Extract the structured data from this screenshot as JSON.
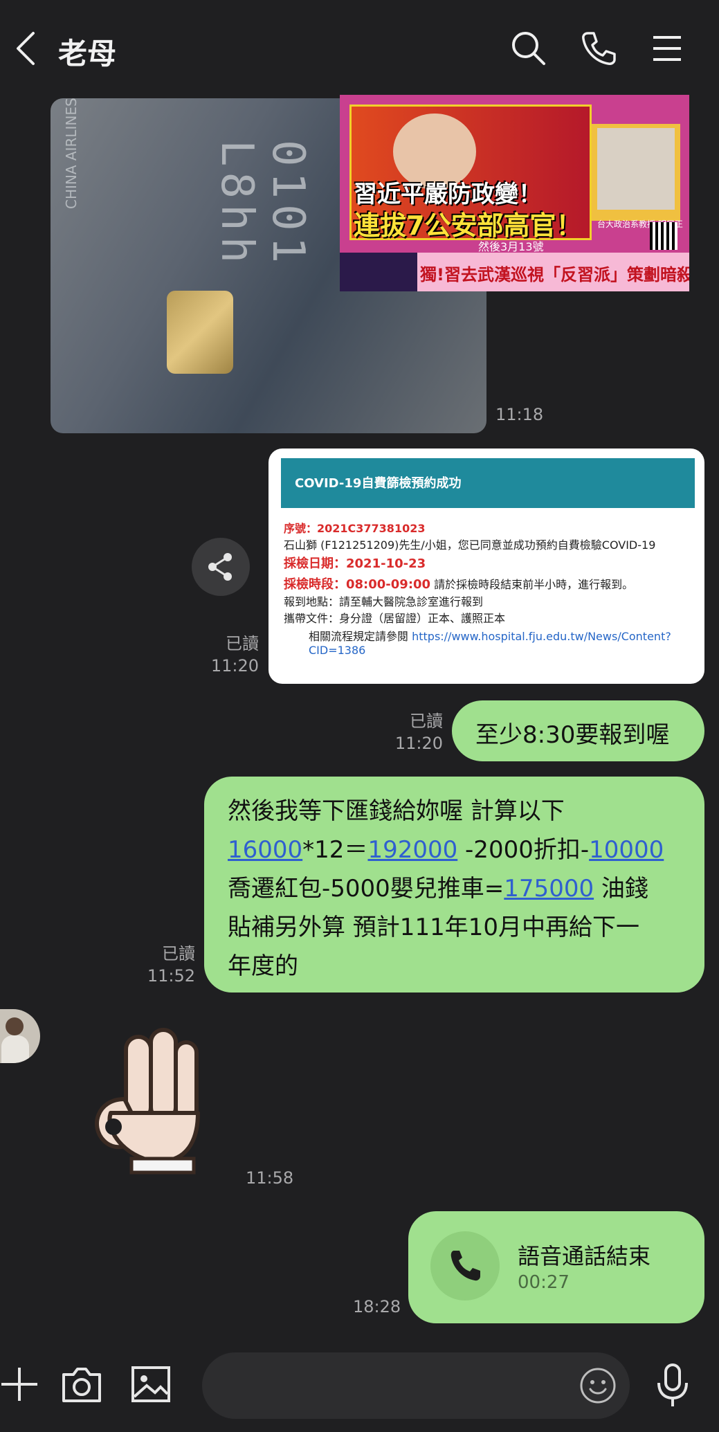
{
  "header": {
    "title": "老母"
  },
  "messages": {
    "card_time": "11:18",
    "news": {
      "headline1": "習近平嚴防政變！",
      "headline2": "連拔7公安部高官！",
      "date": "然後3月13號",
      "bar": "獨!習去武漢巡視「反習派」策劃暗殺!背後操盤手是江派?!",
      "side_label": "台大政治系教授 明居正"
    },
    "covid": {
      "title": "COVID-19自費篩檢預約成功",
      "serial_label": "序號：2021C377381023",
      "line2": "石山獅 (F121251209)先生/小姐，您已同意並成功預約自費檢驗COVID-19",
      "date_label": "採檢日期：2021-10-23",
      "time_label": "採檢時段：08:00-09:00",
      "time_note": " 請於採檢時段結束前半小時，進行報到。",
      "place": "報到地點：請至輔大醫院急診室進行報到",
      "docs": "攜帶文件：身分證（居留證）正本、護照正本",
      "ref_prefix": "相關流程規定請參閱 ",
      "ref_link": "https://www.hospital.fju.edu.tw/News/Content?",
      "ref_link2": "CID=1386",
      "read": "已讀",
      "time": "11:20"
    },
    "msg1": {
      "text": "至少8:30要報到喔",
      "read": "已讀",
      "time": "11:20"
    },
    "msg2": {
      "line1": "然後我等下匯錢給妳喔 計算以下",
      "l2_a": "16000",
      "l2_b": "*12＝",
      "l2_c": "192000",
      "l2_d": " -2000折扣-",
      "l2_e": "10000",
      "l3_a": "喬遷紅包-5000嬰兒推車=",
      "l3_b": "175000",
      "l3_c": " 油錢",
      "line4": "貼補另外算 預計111年10月中再給下一",
      "line5": "年度的",
      "read": "已讀",
      "time": "11:52"
    },
    "sticker_time": "11:58",
    "call": {
      "title": "語音通話結束",
      "duration": "00:27",
      "time": "18:28"
    }
  },
  "colors": {
    "background": "#1f1f21",
    "bubble": "#a0e08e",
    "link": "#2f5fd0"
  }
}
